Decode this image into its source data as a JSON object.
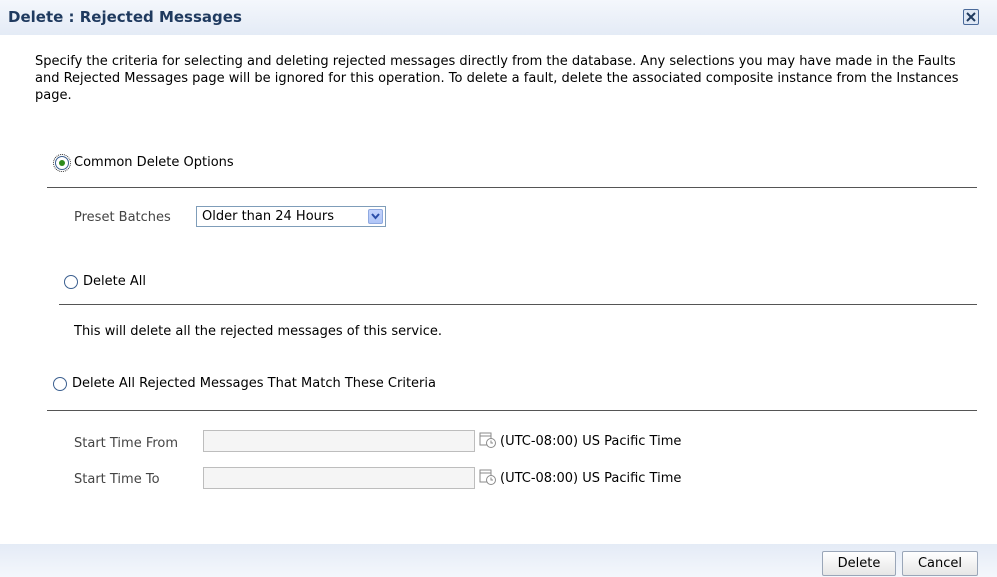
{
  "dialog": {
    "title": "Delete : Rejected Messages",
    "description": "Specify the criteria for selecting and deleting rejected messages directly from the database. Any selections you may have made in the Faults and Rejected Messages page will be ignored for this operation. To delete a fault, delete the associated composite instance from the Instances page."
  },
  "options": {
    "common": {
      "label": "Common Delete Options",
      "selected": true
    },
    "preset": {
      "label": "Preset Batches",
      "value": "Older than 24 Hours"
    },
    "delete_all": {
      "label": "Delete All",
      "selected": false,
      "note": "This will delete all the rejected messages of this service."
    },
    "criteria": {
      "label": "Delete All Rejected Messages That Match These Criteria",
      "selected": false
    }
  },
  "criteria_fields": {
    "start_from": {
      "label": "Start Time From",
      "value": "",
      "timezone": "(UTC-08:00) US Pacific Time"
    },
    "start_to": {
      "label": "Start Time To",
      "value": "",
      "timezone": "(UTC-08:00) US Pacific Time"
    }
  },
  "buttons": {
    "delete": "Delete",
    "cancel": "Cancel"
  },
  "icons": {
    "close": "close-icon",
    "calendar": "calendar-icon",
    "dropdown": "chevron-down-icon"
  },
  "colors": {
    "title_text": "#1f3a5f",
    "header_bg": "#e4ebf6",
    "radio_selected": "#2e8b1a"
  }
}
